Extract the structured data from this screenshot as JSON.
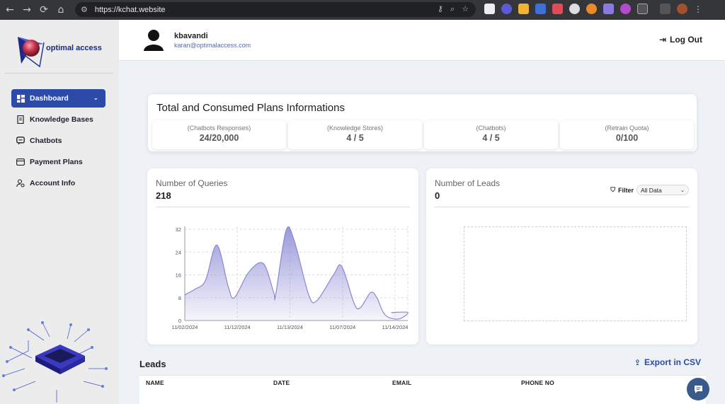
{
  "browser": {
    "url": "https://kchat.website"
  },
  "brand": {
    "logo_text": "optimal access",
    "accent_color": "#2c4aa8"
  },
  "sidebar": {
    "items": [
      {
        "label": "Dashboard",
        "icon": "grid-icon",
        "active": true
      },
      {
        "label": "Knowledge Bases",
        "icon": "book-icon",
        "active": false
      },
      {
        "label": "Chatbots",
        "icon": "chat-icon",
        "active": false
      },
      {
        "label": "Payment Plans",
        "icon": "card-icon",
        "active": false
      },
      {
        "label": "Account Info",
        "icon": "user-settings-icon",
        "active": false
      }
    ]
  },
  "header": {
    "username": "kbavandi",
    "email": "karan@optimalaccess.com",
    "logout_label": "Log Out"
  },
  "plans": {
    "title": "Total and Consumed Plans Informations",
    "stats": [
      {
        "label": "(Chatbots Responses)",
        "value": "24/20,000"
      },
      {
        "label": "(Knowledge Stores)",
        "value": "4 / 5"
      },
      {
        "label": "(Chatbots)",
        "value": "4 / 5"
      },
      {
        "label": "(Retrain Quota)",
        "value": "0/100"
      }
    ]
  },
  "queries": {
    "title": "Number of Queries",
    "value": "218"
  },
  "leads_chart": {
    "title": "Number of Leads",
    "value": "0",
    "filter_label": "Filter",
    "filter_value": "All Data"
  },
  "leads": {
    "title": "Leads",
    "export_label": "Export in CSV",
    "columns": [
      "NAME",
      "DATE",
      "EMAIL",
      "PHONE NO"
    ]
  },
  "chart_data": {
    "type": "area",
    "x": [
      "11/02/2024",
      "11/12/2024",
      "11/13/2024",
      "11/07/2024",
      "11/14/2024"
    ],
    "y_ticks": [
      0,
      8,
      16,
      24,
      32
    ],
    "ylim": [
      0,
      33
    ],
    "series": [
      {
        "points": [
          [
            0.0,
            9
          ],
          [
            0.05,
            11
          ],
          [
            0.1,
            14
          ],
          [
            0.155,
            26.5
          ],
          [
            0.21,
            12
          ],
          [
            0.24,
            8
          ],
          [
            0.31,
            17
          ],
          [
            0.38,
            20
          ],
          [
            0.43,
            10
          ],
          [
            0.44,
            9
          ],
          [
            0.49,
            31.5
          ],
          [
            0.53,
            28
          ],
          [
            0.6,
            9
          ],
          [
            0.64,
            7
          ],
          [
            0.72,
            16
          ],
          [
            0.76,
            19
          ],
          [
            0.82,
            6
          ],
          [
            0.85,
            4.5
          ],
          [
            0.9,
            9.8
          ],
          [
            0.93,
            8
          ],
          [
            0.96,
            3
          ],
          [
            0.99,
            1
          ],
          [
            1.04,
            0.6
          ],
          [
            1.08,
            2.8
          ],
          [
            1.0,
            2.8
          ]
        ]
      }
    ],
    "fill_color": "#8f8ed6",
    "line_color": "#8a88cf"
  }
}
